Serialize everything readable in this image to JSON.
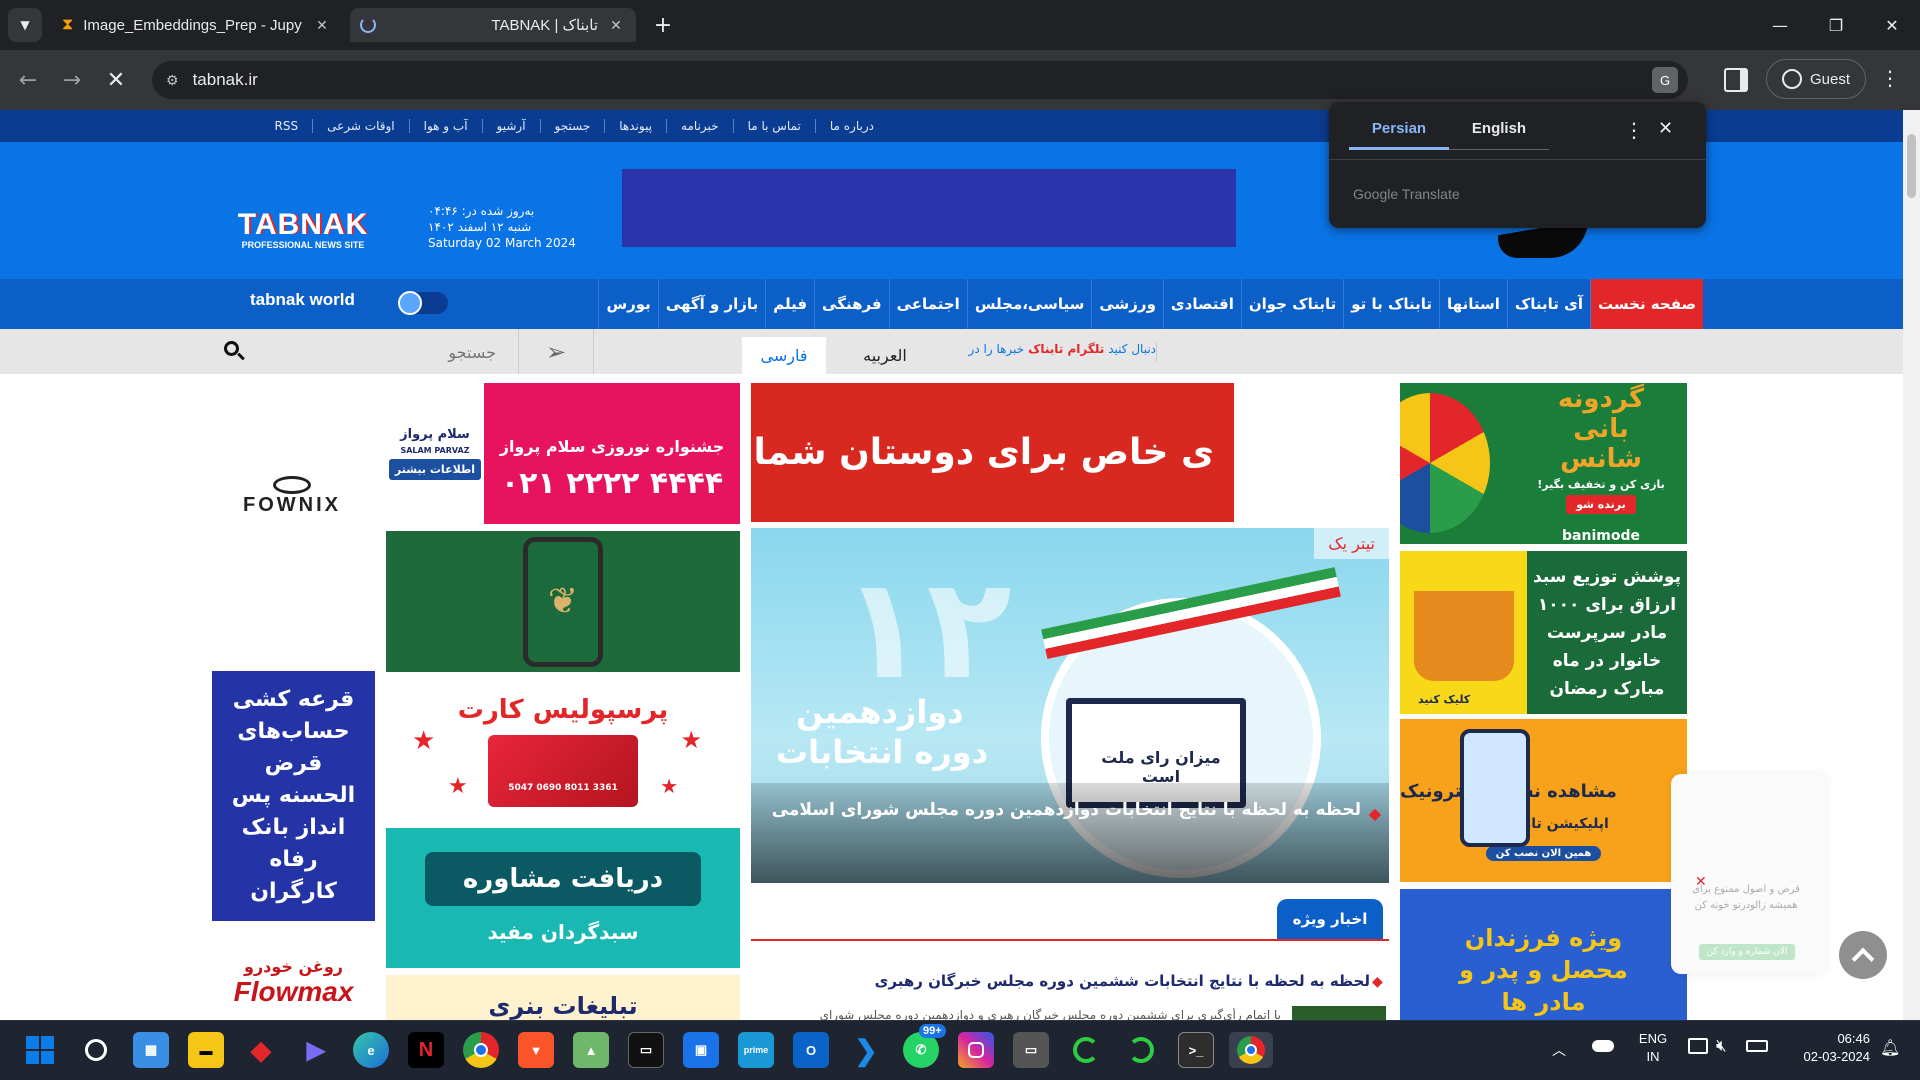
{
  "browser": {
    "tabs": [
      {
        "title": "Image_Embeddings_Prep - Jupy",
        "active": false
      },
      {
        "title": "TABNAK | تابناک",
        "active": true
      }
    ],
    "url": "tabnak.ir",
    "profile_label": "Guest"
  },
  "translate_popup": {
    "lang_source": "Persian",
    "lang_target": "English",
    "brand": "Google Translate"
  },
  "site": {
    "topbar_links": [
      "درباره ما",
      "تماس با ما",
      "خبرنامه",
      "پیوندها",
      "جستجو",
      "آرشیو",
      "آب و هوا",
      "اوقات شرعی",
      "RSS"
    ],
    "logo_text": "TABNAK",
    "logo_sub": "PROFESSIONAL NEWS SITE",
    "updated_label": "به‌روز شده در: ۰۴:۴۶",
    "date_fa": "شنبه ۱۲ اسفند ۱۴۰۲",
    "date_en": "Saturday 02 March 2024",
    "nav_items": [
      "صفحه نخست",
      "آی تابناک",
      "استانها",
      "تابناک با تو",
      "تابناک جوان",
      "اقتصادی",
      "ورزشی",
      "سیاسی،مجلس",
      "اجتماعی",
      "فرهنگی",
      "فیلم",
      "بازار و آگهی",
      "بورس"
    ],
    "tabnak_world": "tabnak world",
    "search_placeholder": "جستجو",
    "lang_tabs": [
      "فارسی",
      "العربیه"
    ],
    "telegram_pre": "خبرها را در",
    "telegram_link": "تلگرام تابناک",
    "telegram_post": "دنبال کنید",
    "top_story_badge": "تیتر یک",
    "top_story_headline": "لحظه به لحظه با نتایج انتخابات دوازدهمین دوره مجلس شورای اسلامی",
    "top_story_art_line1": "دوازدهمین",
    "top_story_art_line2": "دوره انتخابات",
    "top_story_art_ballot": "میزان رای ملت است",
    "special_label": "اخبار ویژه",
    "news1_headline": "لحظه به لحظه با نتایج انتخابات ششمین دوره مجلس خبرگان رهبری",
    "news1_snippet": "با اتمام رأی‌گیری برای ششمین دوره مجلس خبرگان رهبری و دوازدهمین دوره مجلس شورای"
  },
  "ads": {
    "salam_parvaz_title": "جشنواره نوروزی سلام پرواز",
    "salam_parvaz_phone": "۰۲۱ ۲۲۲۲ ۴۴۴۴",
    "salam_parvaz_more": "اطلاعات بیشتر",
    "salam_parvaz_brand": "سلام پرواز",
    "salam_parvaz_brand_en": "SALAM PARVAZ",
    "friends_banner": "ی خاص برای دوستان شما",
    "fownix": "FOWNIX",
    "persepolis": "پرسپولیس کارت",
    "card_number": "5047 0690 8011 3361",
    "consult": "دریافت مشاوره",
    "mofid": "سبدگردان مفید",
    "banner_ads": "تبلیغات بنری",
    "refah_title": "قرعه کشی حساب‌های قرض الحسنه پس انداز بانک رفاه کارگران",
    "refah_bank": "بانک رفاه کارگران",
    "flowmax_fa": "روغن خودرو",
    "flowmax": "Flowmax",
    "banimode_title": "گردونه بانی شانس",
    "banimode_sub": "بازی کن و تخفیف بگیر!",
    "banimode_btn": "برنده شو",
    "banimode_brand": "banimode",
    "sabad_title": "پوشش توزیع سبد ارزاق برای ۱۰۰۰ مادر سرپرست خانوار در ماه مبارک رمضان",
    "sabad_click": "کلیک کنید",
    "tamin_title": "مشاهده نسخه الکترونیک",
    "tamin_app": "اپلیکیشن تامین من",
    "tamin_btn": "همین الان نصب کن",
    "children_title": "ویژه فرزندان محصل و پدر و مادر ها",
    "toast_text": "قرض و اصول ممنوع برای همیشه زالودرتو خونه کن",
    "toast_btn": "الان شماره و وارد کن"
  },
  "taskbar": {
    "lang": "ENG",
    "region": "IN",
    "time": "06:46",
    "date": "02-03-2024",
    "whatsapp_badge": "99+"
  }
}
